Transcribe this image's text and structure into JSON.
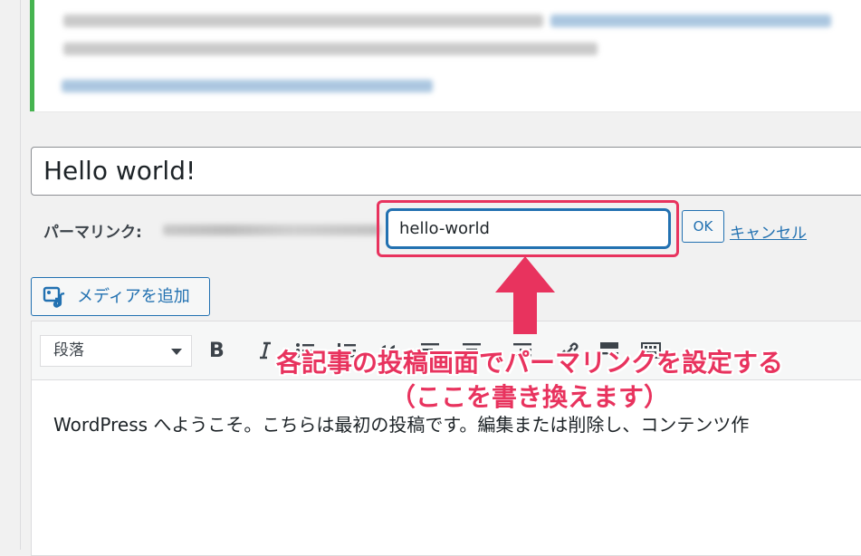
{
  "post": {
    "title": "Hello world!",
    "permalink_label": "パーマリンク:",
    "slug_value": "hello-world",
    "ok_label": "OK",
    "cancel_label": "キャンセル"
  },
  "media": {
    "add_media_label": "メディアを追加",
    "icon": "add-media-icon"
  },
  "editor": {
    "format_selected": "段落",
    "bold_label": "B",
    "content_text": "WordPress へようこそ。こちらは最初の投稿です。編集または削除し、コンテンツ作"
  },
  "annotation": {
    "line1": "各記事の投稿画面でパーマリンクを設定する",
    "line2": "（ここを書き換えます）",
    "color": "#e8335e"
  },
  "colors": {
    "accent": "#2271b1",
    "notice_border": "#46b450",
    "highlight": "#e8335e"
  }
}
